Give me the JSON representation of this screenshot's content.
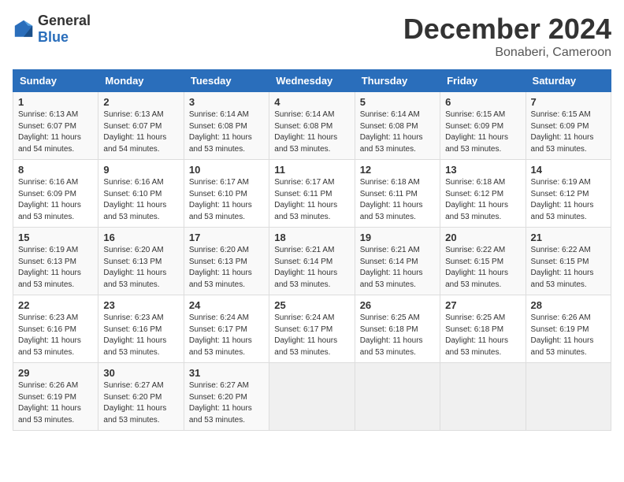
{
  "header": {
    "logo_general": "General",
    "logo_blue": "Blue",
    "title": "December 2024",
    "location": "Bonaberi, Cameroon"
  },
  "columns": [
    "Sunday",
    "Monday",
    "Tuesday",
    "Wednesday",
    "Thursday",
    "Friday",
    "Saturday"
  ],
  "weeks": [
    [
      {
        "day": "1",
        "info": "Sunrise: 6:13 AM\nSunset: 6:07 PM\nDaylight: 11 hours\nand 54 minutes."
      },
      {
        "day": "2",
        "info": "Sunrise: 6:13 AM\nSunset: 6:07 PM\nDaylight: 11 hours\nand 54 minutes."
      },
      {
        "day": "3",
        "info": "Sunrise: 6:14 AM\nSunset: 6:08 PM\nDaylight: 11 hours\nand 53 minutes."
      },
      {
        "day": "4",
        "info": "Sunrise: 6:14 AM\nSunset: 6:08 PM\nDaylight: 11 hours\nand 53 minutes."
      },
      {
        "day": "5",
        "info": "Sunrise: 6:14 AM\nSunset: 6:08 PM\nDaylight: 11 hours\nand 53 minutes."
      },
      {
        "day": "6",
        "info": "Sunrise: 6:15 AM\nSunset: 6:09 PM\nDaylight: 11 hours\nand 53 minutes."
      },
      {
        "day": "7",
        "info": "Sunrise: 6:15 AM\nSunset: 6:09 PM\nDaylight: 11 hours\nand 53 minutes."
      }
    ],
    [
      {
        "day": "8",
        "info": "Sunrise: 6:16 AM\nSunset: 6:09 PM\nDaylight: 11 hours\nand 53 minutes."
      },
      {
        "day": "9",
        "info": "Sunrise: 6:16 AM\nSunset: 6:10 PM\nDaylight: 11 hours\nand 53 minutes."
      },
      {
        "day": "10",
        "info": "Sunrise: 6:17 AM\nSunset: 6:10 PM\nDaylight: 11 hours\nand 53 minutes."
      },
      {
        "day": "11",
        "info": "Sunrise: 6:17 AM\nSunset: 6:11 PM\nDaylight: 11 hours\nand 53 minutes."
      },
      {
        "day": "12",
        "info": "Sunrise: 6:18 AM\nSunset: 6:11 PM\nDaylight: 11 hours\nand 53 minutes."
      },
      {
        "day": "13",
        "info": "Sunrise: 6:18 AM\nSunset: 6:12 PM\nDaylight: 11 hours\nand 53 minutes."
      },
      {
        "day": "14",
        "info": "Sunrise: 6:19 AM\nSunset: 6:12 PM\nDaylight: 11 hours\nand 53 minutes."
      }
    ],
    [
      {
        "day": "15",
        "info": "Sunrise: 6:19 AM\nSunset: 6:13 PM\nDaylight: 11 hours\nand 53 minutes."
      },
      {
        "day": "16",
        "info": "Sunrise: 6:20 AM\nSunset: 6:13 PM\nDaylight: 11 hours\nand 53 minutes."
      },
      {
        "day": "17",
        "info": "Sunrise: 6:20 AM\nSunset: 6:13 PM\nDaylight: 11 hours\nand 53 minutes."
      },
      {
        "day": "18",
        "info": "Sunrise: 6:21 AM\nSunset: 6:14 PM\nDaylight: 11 hours\nand 53 minutes."
      },
      {
        "day": "19",
        "info": "Sunrise: 6:21 AM\nSunset: 6:14 PM\nDaylight: 11 hours\nand 53 minutes."
      },
      {
        "day": "20",
        "info": "Sunrise: 6:22 AM\nSunset: 6:15 PM\nDaylight: 11 hours\nand 53 minutes."
      },
      {
        "day": "21",
        "info": "Sunrise: 6:22 AM\nSunset: 6:15 PM\nDaylight: 11 hours\nand 53 minutes."
      }
    ],
    [
      {
        "day": "22",
        "info": "Sunrise: 6:23 AM\nSunset: 6:16 PM\nDaylight: 11 hours\nand 53 minutes."
      },
      {
        "day": "23",
        "info": "Sunrise: 6:23 AM\nSunset: 6:16 PM\nDaylight: 11 hours\nand 53 minutes."
      },
      {
        "day": "24",
        "info": "Sunrise: 6:24 AM\nSunset: 6:17 PM\nDaylight: 11 hours\nand 53 minutes."
      },
      {
        "day": "25",
        "info": "Sunrise: 6:24 AM\nSunset: 6:17 PM\nDaylight: 11 hours\nand 53 minutes."
      },
      {
        "day": "26",
        "info": "Sunrise: 6:25 AM\nSunset: 6:18 PM\nDaylight: 11 hours\nand 53 minutes."
      },
      {
        "day": "27",
        "info": "Sunrise: 6:25 AM\nSunset: 6:18 PM\nDaylight: 11 hours\nand 53 minutes."
      },
      {
        "day": "28",
        "info": "Sunrise: 6:26 AM\nSunset: 6:19 PM\nDaylight: 11 hours\nand 53 minutes."
      }
    ],
    [
      {
        "day": "29",
        "info": "Sunrise: 6:26 AM\nSunset: 6:19 PM\nDaylight: 11 hours\nand 53 minutes."
      },
      {
        "day": "30",
        "info": "Sunrise: 6:27 AM\nSunset: 6:20 PM\nDaylight: 11 hours\nand 53 minutes."
      },
      {
        "day": "31",
        "info": "Sunrise: 6:27 AM\nSunset: 6:20 PM\nDaylight: 11 hours\nand 53 minutes."
      },
      null,
      null,
      null,
      null
    ]
  ]
}
